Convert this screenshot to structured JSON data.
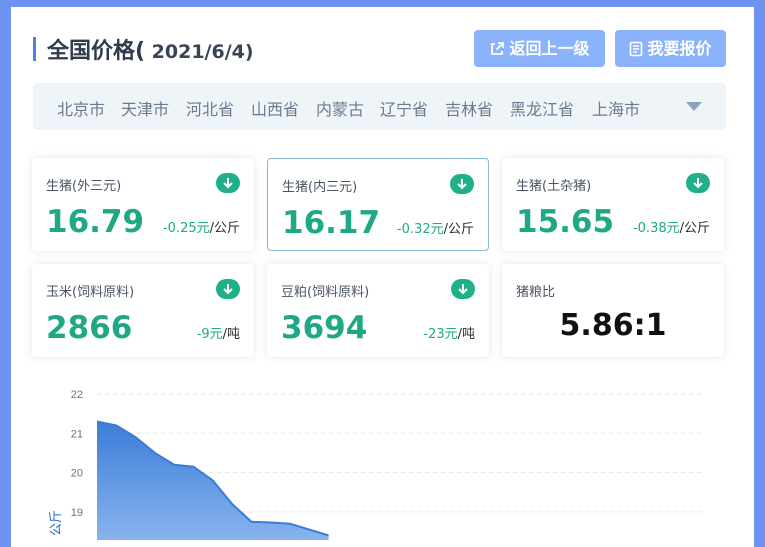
{
  "header": {
    "title": "全国价格(",
    "date": " 2021/6/4)",
    "back_button": "返回上一级",
    "quote_button": "我要报价"
  },
  "cities": [
    "北京市",
    "天津市",
    "河北省",
    "山西省",
    "内蒙古",
    "辽宁省",
    "吉林省",
    "黑龙江省",
    "上海市"
  ],
  "cards": [
    {
      "label": "生猪(外三元)",
      "value": "16.79",
      "change": "-0.25元",
      "unit": "/公斤",
      "trend": "down-arrow-icon"
    },
    {
      "label": "生猪(内三元)",
      "value": "16.17",
      "change": "-0.32元",
      "unit": "/公斤",
      "trend": "down-arrow-icon"
    },
    {
      "label": "生猪(土杂猪)",
      "value": "15.65",
      "change": "-0.38元",
      "unit": "/公斤",
      "trend": "down-arrow-icon"
    },
    {
      "label": "玉米(饲料原料)",
      "value": "2866",
      "change": "-9元",
      "unit": "/吨",
      "trend": "down-arrow-icon"
    },
    {
      "label": "豆粕(饲料原料)",
      "value": "3694",
      "change": "-23元",
      "unit": "/吨",
      "trend": "down-arrow-icon"
    },
    {
      "label": "猪粮比",
      "value": "5.86:1"
    }
  ],
  "colors": {
    "accent": "#4a7fee",
    "button": "#8ab3fb",
    "positive_green": "#1fb08a",
    "area_fill": "#4f8ee3"
  },
  "chart_data": {
    "type": "area",
    "ylabel": "公斤",
    "ylim": [
      18.4,
      22
    ],
    "yticks": [
      22,
      21,
      20,
      19
    ],
    "grid": true,
    "series": [
      {
        "values": [
          21.3,
          21.2,
          20.9,
          20.5,
          20.2,
          20.15,
          19.8,
          19.2,
          18.75,
          18.73,
          18.7,
          18.55,
          18.4
        ]
      }
    ]
  }
}
